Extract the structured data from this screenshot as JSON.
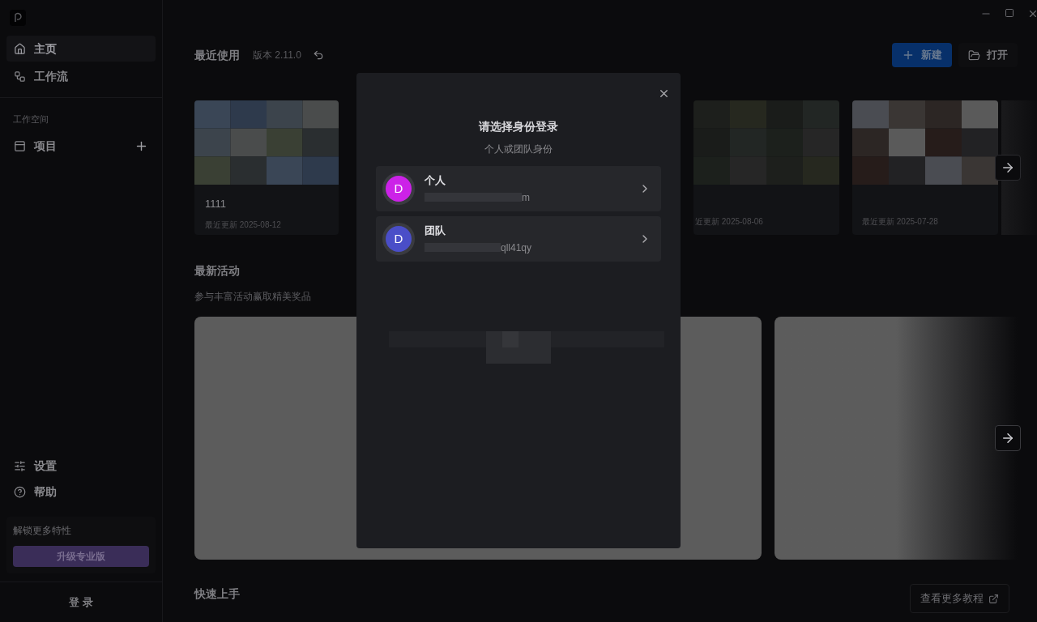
{
  "sidebar": {
    "nav": [
      {
        "label": "主页",
        "selected": true
      },
      {
        "label": "工作流",
        "selected": false
      }
    ],
    "workspace_heading": "工作空间",
    "workspace_item": "项目",
    "bottom_nav": [
      {
        "label": "设置"
      },
      {
        "label": "帮助"
      }
    ],
    "upgrade": {
      "text": "解锁更多特性",
      "button": "升级专业版"
    },
    "login": "登 录"
  },
  "header": {
    "title": "最近使用",
    "version": "版本 2.11.0",
    "buttons": [
      {
        "label": "新建",
        "kind": "primary"
      },
      {
        "label": "打开",
        "kind": "secondary"
      }
    ]
  },
  "recent": [
    {
      "name": "1111",
      "updated": "最近更新 2025-08-12"
    },
    {
      "updated": "近更新 2025-08-06"
    },
    {
      "updated": "最近更新 2025-07-28"
    }
  ],
  "activity": {
    "title": "最新活动",
    "subtitle": "参与丰富活动赢取精美奖品"
  },
  "quickstart": {
    "title": "快速上手",
    "link": "查看更多教程"
  },
  "dialog": {
    "title": "请选择身份登录",
    "subtitle": "个人或团队身份",
    "identities": [
      {
        "avatar": "D",
        "label": "个人",
        "account": "m",
        "color": "#cc22e8"
      },
      {
        "avatar": "D",
        "label": "团队",
        "account": "qll41qy",
        "color": "#4a4ec8"
      }
    ]
  }
}
